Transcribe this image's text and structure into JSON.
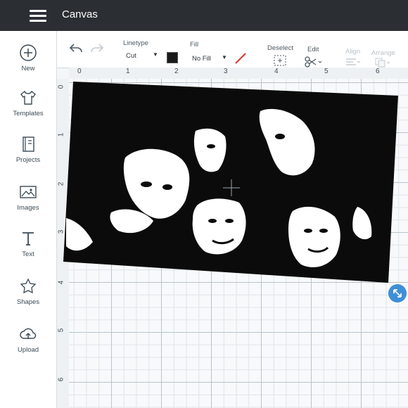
{
  "app": {
    "title": "Canvas"
  },
  "sidebar": {
    "items": [
      {
        "label": "New",
        "icon": "plus-circle-icon"
      },
      {
        "label": "Templates",
        "icon": "tshirt-icon"
      },
      {
        "label": "Projects",
        "icon": "book-icon"
      },
      {
        "label": "Images",
        "icon": "image-icon"
      },
      {
        "label": "Text",
        "icon": "text-icon"
      },
      {
        "label": "Shapes",
        "icon": "shapes-icon"
      },
      {
        "label": "Upload",
        "icon": "upload-cloud-icon"
      }
    ]
  },
  "toolbar": {
    "linetype_label": "Linetype",
    "linetype_value": "Cut",
    "fill_label": "Fill",
    "fill_value": "No Fill",
    "deselect_label": "Deselect",
    "edit_label": "Edit",
    "align_label": "Align",
    "arrange_label": "Arrange"
  },
  "rulers": {
    "top": [
      "0",
      "1",
      "2",
      "3",
      "4",
      "5",
      "6"
    ],
    "left": [
      "0",
      "1",
      "2",
      "3",
      "4",
      "5",
      "6"
    ]
  },
  "colors": {
    "accent": "#3e8fd8",
    "topbar": "#2b2f33",
    "swatch": "#1a1a1a"
  }
}
